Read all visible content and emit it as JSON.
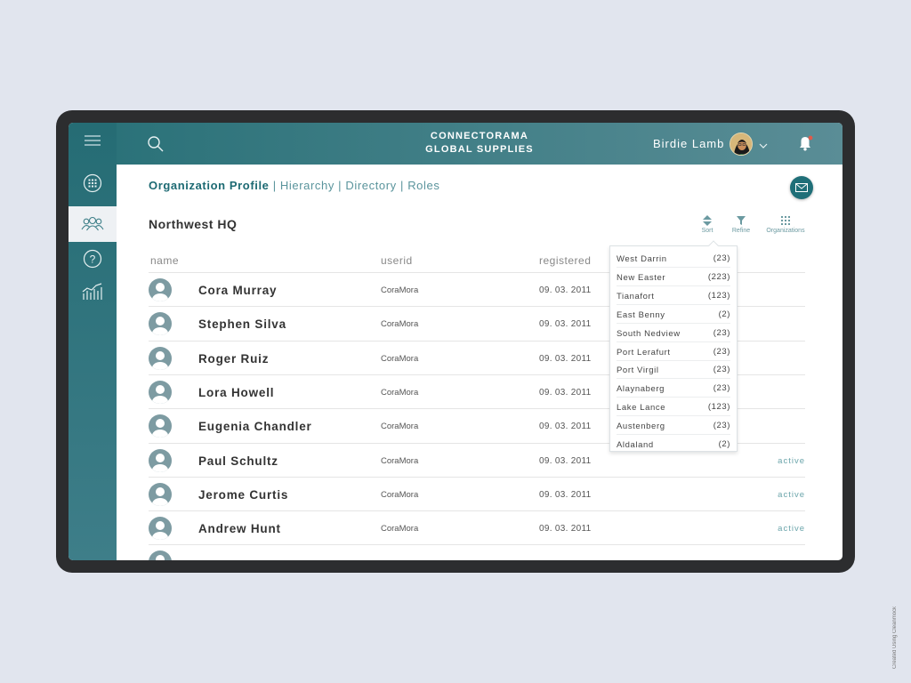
{
  "header": {
    "brand_line1": "CONNECTORAMA",
    "brand_line2": "GLOBAL SUPPLIES",
    "user_name": "Birdie Lamb",
    "notification_dot_color": "#e05a4a"
  },
  "colors": {
    "accent": "#1d6a73",
    "sidebar": "#256c74",
    "status": "#6ba5ab"
  },
  "tabs": {
    "active": "Organization Profile",
    "items": [
      "Hierarchy",
      "Directory",
      "Roles"
    ]
  },
  "page": {
    "title": "Northwest HQ"
  },
  "tools": {
    "sort": "Sort",
    "refine": "Refine",
    "organizations": "Organizations"
  },
  "table": {
    "columns": {
      "name": "name",
      "userid": "userid",
      "registered": "registered"
    },
    "rows": [
      {
        "name": "Cora Murray",
        "userid": "CoraMora",
        "registered": "09. 03. 2011",
        "status": ""
      },
      {
        "name": "Stephen Silva",
        "userid": "CoraMora",
        "registered": "09. 03. 2011",
        "status": ""
      },
      {
        "name": "Roger Ruiz",
        "userid": "CoraMora",
        "registered": "09. 03. 2011",
        "status": ""
      },
      {
        "name": "Lora Howell",
        "userid": "CoraMora",
        "registered": "09. 03. 2011",
        "status": ""
      },
      {
        "name": "Eugenia Chandler",
        "userid": "CoraMora",
        "registered": "09. 03. 2011",
        "status": ""
      },
      {
        "name": "Paul Schultz",
        "userid": "CoraMora",
        "registered": "09. 03. 2011",
        "status": "active"
      },
      {
        "name": "Jerome Curtis",
        "userid": "CoraMora",
        "registered": "09. 03. 2011",
        "status": "active"
      },
      {
        "name": "Andrew Hunt",
        "userid": "CoraMora",
        "registered": "09. 03. 2011",
        "status": "active"
      }
    ]
  },
  "organizations": [
    {
      "name": "West Darrin",
      "count": "(23)"
    },
    {
      "name": "New Easter",
      "count": "(223)"
    },
    {
      "name": "Tianafort",
      "count": "(123)"
    },
    {
      "name": "East Benny",
      "count": "(2)"
    },
    {
      "name": "South Nedview",
      "count": "(23)"
    },
    {
      "name": "Port Lerafurt",
      "count": "(23)"
    },
    {
      "name": "Port Virgil",
      "count": "(23)"
    },
    {
      "name": "Alaynaberg",
      "count": "(23)"
    },
    {
      "name": "Lake Lance",
      "count": "(123)"
    },
    {
      "name": "Austenberg",
      "count": "(23)"
    },
    {
      "name": "Aldaland",
      "count": "(2)"
    }
  ],
  "watermark": "Created Using Cleanmock"
}
